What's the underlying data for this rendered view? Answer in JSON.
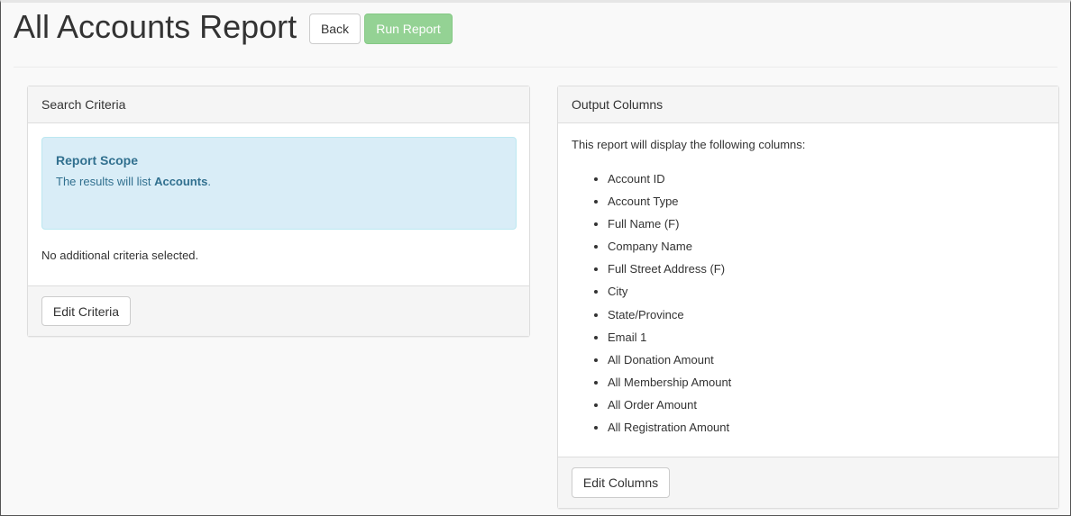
{
  "header": {
    "title": "All Accounts Report",
    "back_label": "Back",
    "run_label": "Run Report"
  },
  "search_panel": {
    "heading": "Search Criteria",
    "scope_title": "Report Scope",
    "scope_text_prefix": "The results will list ",
    "scope_text_bold": "Accounts",
    "scope_text_suffix": ".",
    "no_criteria_text": "No additional criteria selected.",
    "edit_label": "Edit Criteria"
  },
  "output_panel": {
    "heading": "Output Columns",
    "intro": "This report will display the following columns:",
    "columns": [
      "Account ID",
      "Account Type",
      "Full Name (F)",
      "Company Name",
      "Full Street Address (F)",
      "City",
      "State/Province",
      "Email 1",
      "All Donation Amount",
      "All Membership Amount",
      "All Order Amount",
      "All Registration Amount"
    ],
    "edit_label": "Edit Columns"
  },
  "colors": {
    "run_button": "#8fd08f",
    "alert_background": "#d9edf7",
    "alert_text": "#31708f"
  }
}
